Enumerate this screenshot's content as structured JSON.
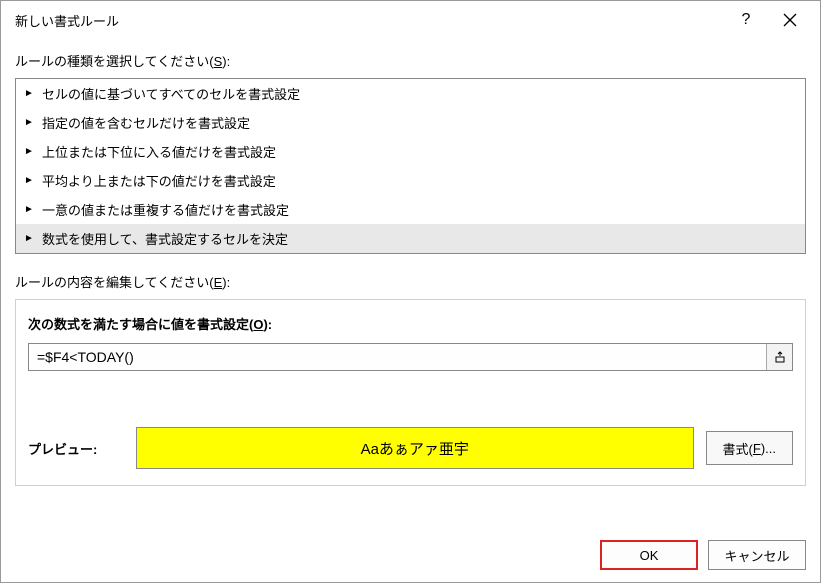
{
  "titlebar": {
    "title": "新しい書式ルール",
    "help": "?",
    "close": "✕"
  },
  "ruleTypeLabel": {
    "prefix": "ルールの種類を選択してください(",
    "access": "S",
    "suffix": "):"
  },
  "ruleTypes": [
    "セルの値に基づいてすべてのセルを書式設定",
    "指定の値を含むセルだけを書式設定",
    "上位または下位に入る値だけを書式設定",
    "平均より上または下の値だけを書式設定",
    "一意の値または重複する値だけを書式設定",
    "数式を使用して、書式設定するセルを決定"
  ],
  "selectedRuleIndex": 5,
  "ruleEditLabel": {
    "prefix": "ルールの内容を編集してください(",
    "access": "E",
    "suffix": "):"
  },
  "formulaLabel": {
    "prefix": "次の数式を満たす場合に値を書式設定(",
    "access": "O",
    "suffix": "):"
  },
  "formulaValue": "=$F4<TODAY()",
  "preview": {
    "label": "プレビュー:",
    "sample": "Aaあぁアァ亜宇",
    "bg": "#ffff00"
  },
  "formatBtn": {
    "prefix": "書式(",
    "access": "F",
    "suffix": ")..."
  },
  "buttons": {
    "ok": "OK",
    "cancel": "キャンセル"
  }
}
